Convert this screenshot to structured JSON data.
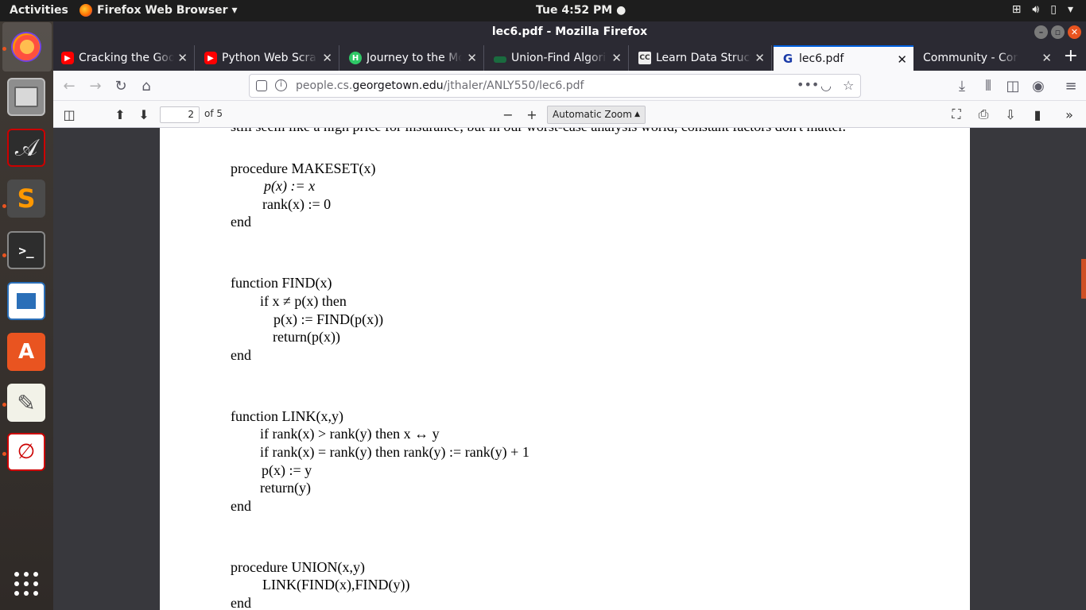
{
  "topbar": {
    "activities": "Activities",
    "app_menu": "Firefox Web Browser ▾",
    "clock": "Tue  4:52 PM ●",
    "tray_icons": [
      "network-icon",
      "volume-icon",
      "battery-icon",
      "power-menu-icon"
    ]
  },
  "dock": {
    "items": [
      "firefox",
      "files",
      "pdf-reader",
      "sublime-text",
      "terminal",
      "libreoffice-writer",
      "software-center",
      "text-editor",
      "document-viewer",
      "show-applications"
    ]
  },
  "window": {
    "title": "lec6.pdf - Mozilla Firefox"
  },
  "tabs": [
    {
      "label": "Cracking the Google",
      "favicon": "youtube"
    },
    {
      "label": "Python Web Scraping",
      "favicon": "youtube"
    },
    {
      "label": "Journey to the Mount",
      "favicon": "hackerrank"
    },
    {
      "label": "Union-Find Algorithm",
      "favicon": "union-find"
    },
    {
      "label": "Learn Data Structures",
      "favicon": "cc"
    },
    {
      "label": "lec6.pdf",
      "favicon": "georgetown",
      "active": true
    },
    {
      "label": "Community - Competitive",
      "favicon": "none"
    }
  ],
  "navbar": {
    "url_prefix": "people.cs.",
    "url_domain": "georgetown.edu",
    "url_path": "/jthaler/ANLY550/lec6.pdf",
    "more": "•••"
  },
  "pdf_toolbar": {
    "page_number": "2",
    "page_of": "of 5",
    "zoom": "Automatic Zoom"
  },
  "pdf_content": {
    "partial_line": "still seem like a high price for insurance, but in our worst-case analysis world, constant factors don't matter.",
    "makeset": [
      "procedure MAKESET(x)",
      "p(x) := x",
      "rank(x) := 0",
      "end"
    ],
    "find": [
      "function FIND(x)",
      "if x ≠ p(x) then",
      "p(x) := FIND(p(x))",
      "return(p(x))",
      "end"
    ],
    "link": [
      "function LINK(x,y)",
      "if rank(x) > rank(y) then x ↔ y",
      "if rank(x) = rank(y) then rank(y) := rank(y) + 1",
      "p(x) := y",
      "return(y)",
      "end"
    ],
    "union": [
      "procedure UNION(x,y)",
      "LINK(FIND(x),FIND(y))",
      "end"
    ]
  }
}
